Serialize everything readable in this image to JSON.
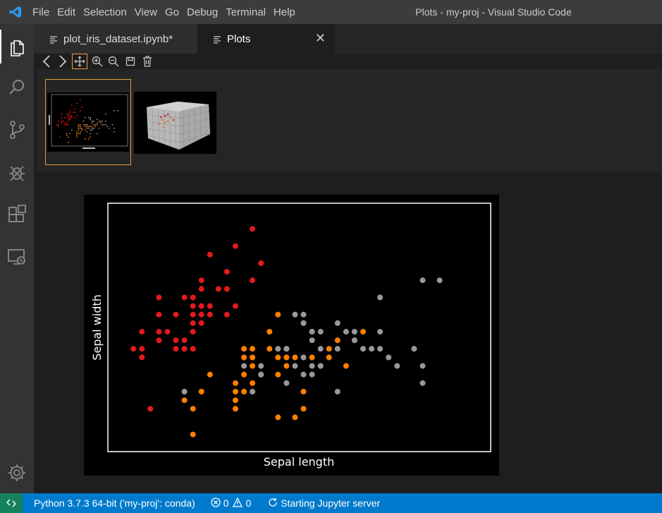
{
  "window": {
    "title": "Plots - my-proj - Visual Studio Code"
  },
  "menu": [
    "File",
    "Edit",
    "Selection",
    "View",
    "Go",
    "Debug",
    "Terminal",
    "Help"
  ],
  "tabs": [
    {
      "label": "plot_iris_dataset.ipynb*",
      "icon": "lines-icon",
      "active": false
    },
    {
      "label": "Plots",
      "icon": "lines-icon",
      "active": true,
      "close": "✕"
    }
  ],
  "activitybar": [
    "explorer-icon",
    "search-icon",
    "source-control-icon",
    "debug-icon",
    "extensions-icon",
    "remote-explorer-icon",
    "gear-icon"
  ],
  "toolbar": [
    "prev-icon",
    "next-icon",
    "pan-icon",
    "zoom-in-icon",
    "zoom-out-icon",
    "save-icon",
    "delete-icon"
  ],
  "status": {
    "python": "Python 3.7.3 64-bit ('my-proj': conda)",
    "errors": "0",
    "warnings": "0",
    "jupyter": "Starting Jupyter server"
  },
  "chart_data": {
    "type": "scatter",
    "xlabel": "Sepal length",
    "ylabel": "Sepal width",
    "xlim": [
      4.0,
      8.5
    ],
    "ylim": [
      1.8,
      4.7
    ],
    "grid": false,
    "colors": {
      "setosa": "#e31a1c",
      "versicolor": "#ff7f00",
      "virginica": "#999999"
    },
    "series": [
      {
        "color": "#e31a1c",
        "points": [
          [
            4.3,
            3.0
          ],
          [
            4.4,
            2.9
          ],
          [
            4.4,
            3.0
          ],
          [
            4.4,
            3.2
          ],
          [
            4.5,
            2.3
          ],
          [
            4.6,
            3.1
          ],
          [
            4.6,
            3.4
          ],
          [
            4.6,
            3.6
          ],
          [
            4.6,
            3.2
          ],
          [
            4.7,
            3.2
          ],
          [
            4.8,
            3.4
          ],
          [
            4.8,
            3.0
          ],
          [
            4.8,
            3.1
          ],
          [
            4.9,
            3.0
          ],
          [
            4.9,
            3.1
          ],
          [
            4.9,
            3.6
          ],
          [
            5.0,
            3.6
          ],
          [
            5.0,
            3.4
          ],
          [
            5.0,
            3.0
          ],
          [
            5.0,
            3.3
          ],
          [
            5.0,
            3.2
          ],
          [
            5.0,
            3.5
          ],
          [
            5.1,
            3.5
          ],
          [
            5.1,
            3.8
          ],
          [
            5.1,
            3.3
          ],
          [
            5.1,
            3.4
          ],
          [
            5.1,
            3.7
          ],
          [
            5.2,
            3.5
          ],
          [
            5.2,
            3.4
          ],
          [
            5.2,
            4.1
          ],
          [
            5.3,
            3.7
          ],
          [
            5.4,
            3.9
          ],
          [
            5.4,
            3.7
          ],
          [
            5.4,
            3.4
          ],
          [
            5.5,
            4.2
          ],
          [
            5.5,
            3.5
          ],
          [
            5.7,
            4.4
          ],
          [
            5.7,
            3.8
          ],
          [
            5.8,
            4.0
          ]
        ]
      },
      {
        "color": "#ff7f00",
        "points": [
          [
            4.9,
            2.4
          ],
          [
            5.0,
            2.0
          ],
          [
            5.0,
            2.3
          ],
          [
            5.1,
            2.5
          ],
          [
            5.2,
            2.7
          ],
          [
            5.5,
            2.3
          ],
          [
            5.5,
            2.4
          ],
          [
            5.5,
            2.6
          ],
          [
            5.5,
            2.5
          ],
          [
            5.6,
            2.9
          ],
          [
            5.6,
            3.0
          ],
          [
            5.6,
            2.5
          ],
          [
            5.6,
            2.7
          ],
          [
            5.7,
            2.8
          ],
          [
            5.7,
            2.6
          ],
          [
            5.7,
            3.0
          ],
          [
            5.7,
            2.9
          ],
          [
            5.8,
            2.7
          ],
          [
            5.9,
            3.0
          ],
          [
            5.9,
            3.2
          ],
          [
            6.0,
            2.2
          ],
          [
            6.0,
            2.9
          ],
          [
            6.0,
            2.7
          ],
          [
            6.0,
            3.4
          ],
          [
            6.1,
            2.9
          ],
          [
            6.1,
            2.8
          ],
          [
            6.1,
            3.0
          ],
          [
            6.2,
            2.2
          ],
          [
            6.2,
            2.9
          ],
          [
            6.3,
            3.3
          ],
          [
            6.3,
            2.5
          ],
          [
            6.3,
            2.3
          ],
          [
            6.4,
            3.2
          ],
          [
            6.4,
            2.9
          ],
          [
            6.5,
            2.8
          ],
          [
            6.6,
            2.9
          ],
          [
            6.6,
            3.0
          ],
          [
            6.7,
            3.1
          ],
          [
            6.8,
            2.8
          ],
          [
            6.9,
            3.1
          ],
          [
            7.0,
            3.2
          ]
        ]
      },
      {
        "color": "#999999",
        "points": [
          [
            4.9,
            2.5
          ],
          [
            5.6,
            2.8
          ],
          [
            5.7,
            2.5
          ],
          [
            5.8,
            2.7
          ],
          [
            5.8,
            2.8
          ],
          [
            6.0,
            3.0
          ],
          [
            6.1,
            3.0
          ],
          [
            6.1,
            2.6
          ],
          [
            6.2,
            3.4
          ],
          [
            6.2,
            2.8
          ],
          [
            6.3,
            3.3
          ],
          [
            6.3,
            3.4
          ],
          [
            6.3,
            2.7
          ],
          [
            6.3,
            2.9
          ],
          [
            6.4,
            3.1
          ],
          [
            6.4,
            2.8
          ],
          [
            6.4,
            2.7
          ],
          [
            6.4,
            3.2
          ],
          [
            6.5,
            3.0
          ],
          [
            6.5,
            3.2
          ],
          [
            6.5,
            2.8
          ],
          [
            6.7,
            3.3
          ],
          [
            6.7,
            3.0
          ],
          [
            6.7,
            2.5
          ],
          [
            6.8,
            3.2
          ],
          [
            6.9,
            3.1
          ],
          [
            6.9,
            3.2
          ],
          [
            7.0,
            3.0
          ],
          [
            7.1,
            3.0
          ],
          [
            7.2,
            3.6
          ],
          [
            7.2,
            3.2
          ],
          [
            7.2,
            3.0
          ],
          [
            7.3,
            2.9
          ],
          [
            7.4,
            2.8
          ],
          [
            7.6,
            3.0
          ],
          [
            7.7,
            3.8
          ],
          [
            7.7,
            2.6
          ],
          [
            7.7,
            2.8
          ],
          [
            7.9,
            3.8
          ]
        ]
      }
    ]
  }
}
